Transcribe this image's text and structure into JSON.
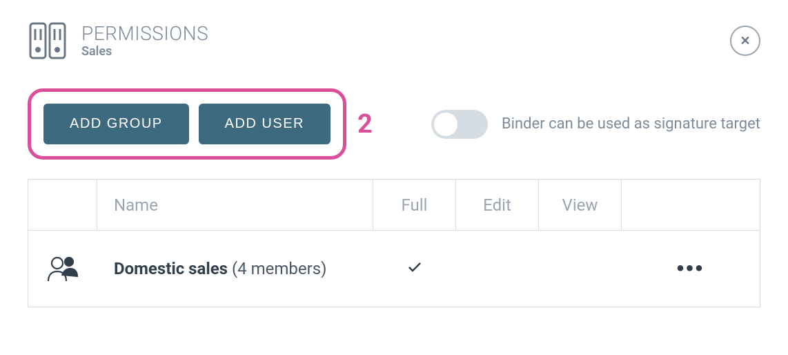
{
  "header": {
    "title": "PERMISSIONS",
    "subtitle": "Sales"
  },
  "actions": {
    "add_group_label": "ADD GROUP",
    "add_user_label": "ADD USER",
    "step_marker": "2"
  },
  "toggle": {
    "label": "Binder can be used as signature target",
    "enabled": false
  },
  "table": {
    "headers": {
      "name": "Name",
      "full": "Full",
      "edit": "Edit",
      "view": "View"
    },
    "rows": [
      {
        "name": "Domestic sales",
        "members_text": "(4 members)",
        "full": true,
        "edit": false,
        "view": false
      }
    ]
  }
}
